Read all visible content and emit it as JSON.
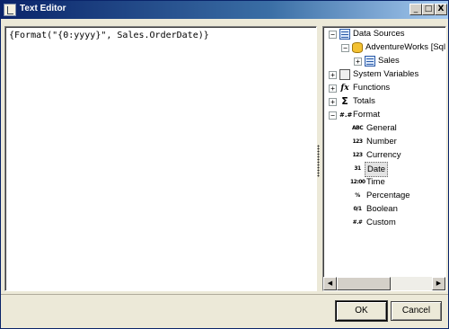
{
  "window": {
    "title": "Text Editor",
    "controls": {
      "minimize": "_",
      "maximize": "□",
      "close": "X"
    }
  },
  "editor": {
    "expression": "{Format(\"{0:yyyy}\", Sales.OrderDate)}"
  },
  "tree": {
    "data_sources": {
      "label": "Data Sources",
      "expander": "−",
      "icon": "database-icon",
      "connection": {
        "label": "AdventureWorks [Sql C",
        "expander": "−",
        "icon": "database-cylinder-icon",
        "table": {
          "label": "Sales",
          "expander": "+",
          "icon": "table-icon"
        }
      }
    },
    "system_variables": {
      "label": "System Variables",
      "expander": "+",
      "icon": "system-variables-icon"
    },
    "functions": {
      "label": "Functions",
      "expander": "+",
      "icon": "function-fx-icon",
      "glyph": "fx"
    },
    "totals": {
      "label": "Totals",
      "expander": "+",
      "icon": "sigma-icon",
      "glyph": "Σ"
    },
    "format": {
      "label": "Format",
      "expander": "−",
      "icon": "format-icon",
      "glyph": "#.#",
      "items": [
        {
          "label": "General",
          "glyph": "ABC"
        },
        {
          "label": "Number",
          "glyph": "123"
        },
        {
          "label": "Currency",
          "glyph": "123"
        },
        {
          "label": "Date",
          "glyph": "31",
          "selected": true
        },
        {
          "label": "Time",
          "glyph": "12:00"
        },
        {
          "label": "Percentage",
          "glyph": "%"
        },
        {
          "label": "Boolean",
          "glyph": "0/1"
        },
        {
          "label": "Custom",
          "glyph": "#.#"
        }
      ]
    },
    "scrollbar": {
      "left_arrow": "◀",
      "right_arrow": "▶"
    }
  },
  "buttons": {
    "ok": "OK",
    "cancel": "Cancel"
  },
  "colors": {
    "titlebar_start": "#0a246a",
    "titlebar_end": "#a6caf0",
    "dialog_bg": "#ece9d8"
  }
}
